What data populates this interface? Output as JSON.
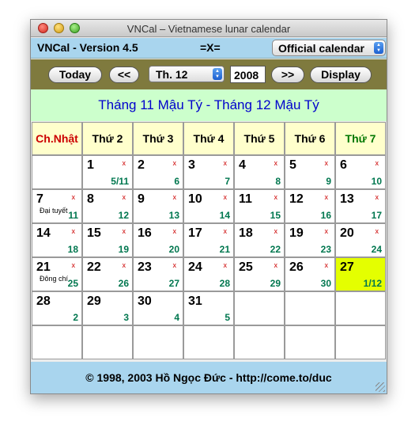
{
  "window": {
    "title": "VNCal – Vietnamese lunar calendar"
  },
  "header": {
    "version": "VNCal - Version 4.5",
    "center_mark": "=X=",
    "calendar_select": "Official calendar"
  },
  "toolbar": {
    "today_label": "Today",
    "prev_label": "<<",
    "month_select": "Th. 12",
    "year_value": "2008",
    "next_label": ">>",
    "display_label": "Display"
  },
  "lunar_header": "Tháng 11 Mậu Tý - Tháng 12 Mậu Tý",
  "weekdays": [
    "Ch.Nhật",
    "Thứ 2",
    "Thứ 3",
    "Thứ 4",
    "Thứ 5",
    "Thứ 6",
    "Thứ 7"
  ],
  "weeks": [
    [
      {
        "solar": "",
        "lunar": "",
        "mark": "",
        "event": ""
      },
      {
        "solar": "1",
        "lunar": "5/11",
        "mark": "x",
        "event": ""
      },
      {
        "solar": "2",
        "lunar": "6",
        "mark": "x",
        "event": ""
      },
      {
        "solar": "3",
        "lunar": "7",
        "mark": "x",
        "event": ""
      },
      {
        "solar": "4",
        "lunar": "8",
        "mark": "x",
        "event": ""
      },
      {
        "solar": "5",
        "lunar": "9",
        "mark": "x",
        "event": ""
      },
      {
        "solar": "6",
        "lunar": "10",
        "mark": "x",
        "event": ""
      }
    ],
    [
      {
        "solar": "7",
        "lunar": "11",
        "mark": "x",
        "event": "Đại tuyết"
      },
      {
        "solar": "8",
        "lunar": "12",
        "mark": "x",
        "event": ""
      },
      {
        "solar": "9",
        "lunar": "13",
        "mark": "x",
        "event": ""
      },
      {
        "solar": "10",
        "lunar": "14",
        "mark": "x",
        "event": ""
      },
      {
        "solar": "11",
        "lunar": "15",
        "mark": "x",
        "event": ""
      },
      {
        "solar": "12",
        "lunar": "16",
        "mark": "x",
        "event": ""
      },
      {
        "solar": "13",
        "lunar": "17",
        "mark": "x",
        "event": ""
      }
    ],
    [
      {
        "solar": "14",
        "lunar": "18",
        "mark": "x",
        "event": ""
      },
      {
        "solar": "15",
        "lunar": "19",
        "mark": "x",
        "event": ""
      },
      {
        "solar": "16",
        "lunar": "20",
        "mark": "x",
        "event": ""
      },
      {
        "solar": "17",
        "lunar": "21",
        "mark": "x",
        "event": ""
      },
      {
        "solar": "18",
        "lunar": "22",
        "mark": "x",
        "event": ""
      },
      {
        "solar": "19",
        "lunar": "23",
        "mark": "x",
        "event": ""
      },
      {
        "solar": "20",
        "lunar": "24",
        "mark": "x",
        "event": ""
      }
    ],
    [
      {
        "solar": "21",
        "lunar": "25",
        "mark": "x",
        "event": "Đông chí"
      },
      {
        "solar": "22",
        "lunar": "26",
        "mark": "x",
        "event": ""
      },
      {
        "solar": "23",
        "lunar": "27",
        "mark": "x",
        "event": ""
      },
      {
        "solar": "24",
        "lunar": "28",
        "mark": "x",
        "event": ""
      },
      {
        "solar": "25",
        "lunar": "29",
        "mark": "x",
        "event": ""
      },
      {
        "solar": "26",
        "lunar": "30",
        "mark": "x",
        "event": ""
      },
      {
        "solar": "27",
        "lunar": "1/12",
        "mark": "",
        "event": "",
        "today": true
      }
    ],
    [
      {
        "solar": "28",
        "lunar": "2",
        "mark": "",
        "event": ""
      },
      {
        "solar": "29",
        "lunar": "3",
        "mark": "",
        "event": ""
      },
      {
        "solar": "30",
        "lunar": "4",
        "mark": "",
        "event": ""
      },
      {
        "solar": "31",
        "lunar": "5",
        "mark": "",
        "event": ""
      },
      {
        "solar": "",
        "lunar": "",
        "mark": "",
        "event": ""
      },
      {
        "solar": "",
        "lunar": "",
        "mark": "",
        "event": ""
      },
      {
        "solar": "",
        "lunar": "",
        "mark": "",
        "event": ""
      }
    ],
    [
      {
        "solar": "",
        "lunar": "",
        "mark": "",
        "event": ""
      },
      {
        "solar": "",
        "lunar": "",
        "mark": "",
        "event": ""
      },
      {
        "solar": "",
        "lunar": "",
        "mark": "",
        "event": ""
      },
      {
        "solar": "",
        "lunar": "",
        "mark": "",
        "event": ""
      },
      {
        "solar": "",
        "lunar": "",
        "mark": "",
        "event": ""
      },
      {
        "solar": "",
        "lunar": "",
        "mark": "",
        "event": ""
      },
      {
        "solar": "",
        "lunar": "",
        "mark": "",
        "event": ""
      }
    ]
  ],
  "footer": "© 1998, 2003 Hồ Ngọc Đức - http://come.to/duc",
  "colors": {
    "header_bg": "#a9d5ee",
    "toolbar_bg": "#7f7a3e",
    "lunar_band_bg": "#ccffcc",
    "weekday_bg": "#ffffcc",
    "today_bg": "#e4ff00",
    "sunday_text": "#cc0000",
    "saturday_text": "#007700",
    "lunar_text": "#00774f"
  }
}
